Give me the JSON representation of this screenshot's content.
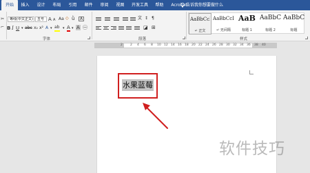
{
  "ribbon_tabs": [
    "开始",
    "插入",
    "设计",
    "布局",
    "引用",
    "邮件",
    "审阅",
    "视图",
    "开发工具",
    "帮助",
    "Acrobat"
  ],
  "tell_me": "告诉我你想要做什么",
  "font": {
    "name": "等线(中文正文)",
    "size": "五号",
    "grow": "A",
    "shrink": "A",
    "bold": "B",
    "italic": "I",
    "underline": "U",
    "strike": "abc",
    "highlight": "ab",
    "color": "A"
  },
  "groups": {
    "font": "字体",
    "paragraph": "段落",
    "styles": "样式"
  },
  "styles": [
    {
      "sample": "AaBbCcI",
      "name": "↵ 正文"
    },
    {
      "sample": "AaBbCcI",
      "name": "↵ 无间隔"
    },
    {
      "sample": "AaB",
      "name": "标题 1"
    },
    {
      "sample": "AaBbC",
      "name": "标题 2"
    },
    {
      "sample": "AaBbC",
      "name": "标题"
    }
  ],
  "ruler_numbers": [
    "2",
    "2",
    "4",
    "6",
    "8",
    "10",
    "12",
    "14",
    "16",
    "18",
    "20",
    "22",
    "24",
    "26",
    "28",
    "30",
    "32",
    "34",
    "36",
    "38",
    "40"
  ],
  "document": {
    "selected_text": "水果蓝莓"
  },
  "watermark": "软件技巧",
  "colors": {
    "ribbon_blue": "#2b579a",
    "annotation_red": "#d01f1f",
    "highlight_yellow": "#ffff00",
    "font_red": "#e00000"
  }
}
